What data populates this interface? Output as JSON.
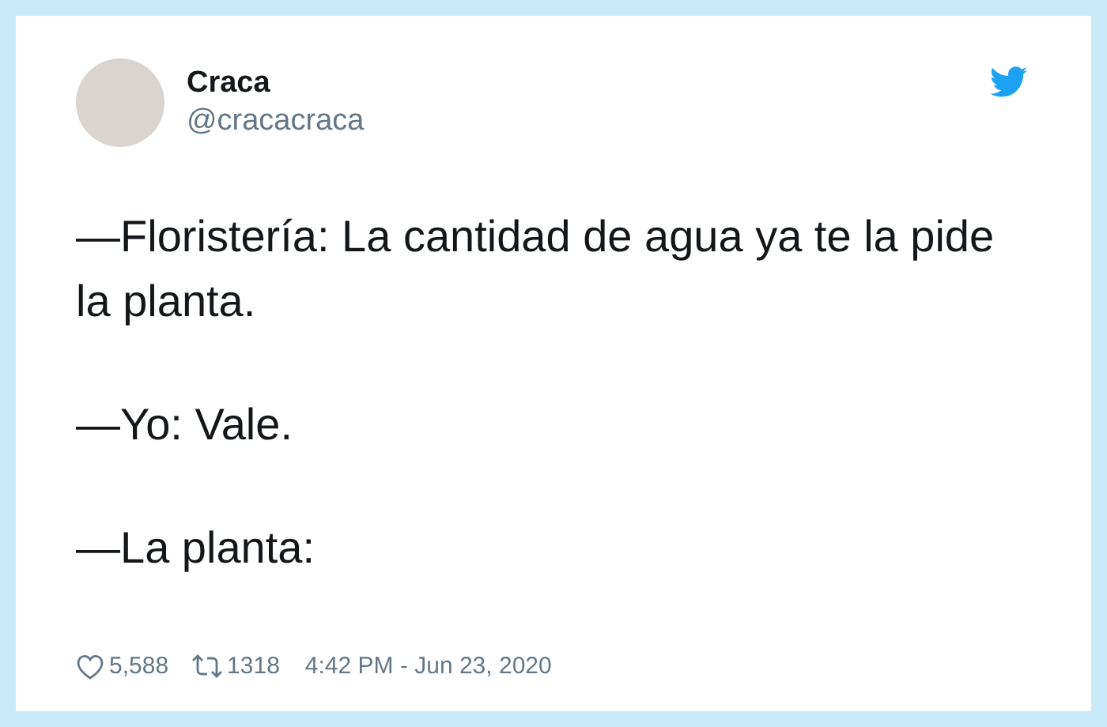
{
  "author": {
    "name": "Craca",
    "handle": "@cracacraca"
  },
  "paragraphs": [
    "—Floristería: La cantidad de agua ya te la pide la planta.",
    "—Yo: Vale.",
    "—La planta:"
  ],
  "footer": {
    "likes": "5,588",
    "retweets": "1318",
    "timestamp": "4:42 PM - Jun 23, 2020"
  }
}
